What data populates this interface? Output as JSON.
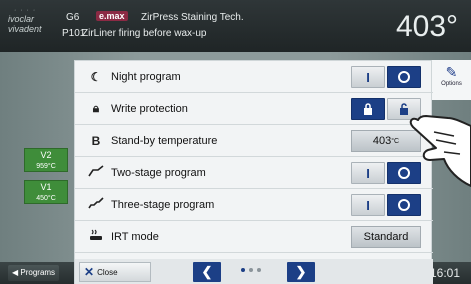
{
  "header": {
    "logo_line1": "ivoclar",
    "logo_line2": "vivadent",
    "program_code": "G6",
    "brand": "e.max",
    "program_title": "ZirPress Staining Tech.",
    "program_number": "P101",
    "program_name": "ZirLiner firing before wax-up",
    "temperature": "403°"
  },
  "side": {
    "v2_label": "V2",
    "v2_value": "959°C",
    "v1_label": "V1",
    "v1_value": "450°C"
  },
  "options_tab": {
    "icon": "pen-icon",
    "label": "Options"
  },
  "rows": [
    {
      "icon": "moon-icon",
      "label": "Night program",
      "control": "toggle",
      "state": "off"
    },
    {
      "icon": "lock-icon",
      "label": "Write protection",
      "control": "toggle",
      "state": "on"
    },
    {
      "icon": "b-icon",
      "label": "Stand-by temperature",
      "control": "value",
      "value": "403",
      "unit": "°C"
    },
    {
      "icon": "two-stage-icon",
      "label": "Two-stage program",
      "control": "toggle",
      "state": "off"
    },
    {
      "icon": "three-stage-icon",
      "label": "Three-stage program",
      "control": "toggle",
      "state": "off"
    },
    {
      "icon": "irt-icon",
      "label": "IRT mode",
      "control": "value",
      "value": "Standard"
    }
  ],
  "toggle": {
    "on_symbol": "I"
  },
  "footer": {
    "close_label": "Close",
    "page_current": 1,
    "page_total": 3
  },
  "bottom": {
    "programs_label": "Programs",
    "clock": "16:01"
  },
  "colors": {
    "accent": "#1c3f86",
    "side_green": "#3f8d3a",
    "brand": "#8b2a44"
  }
}
